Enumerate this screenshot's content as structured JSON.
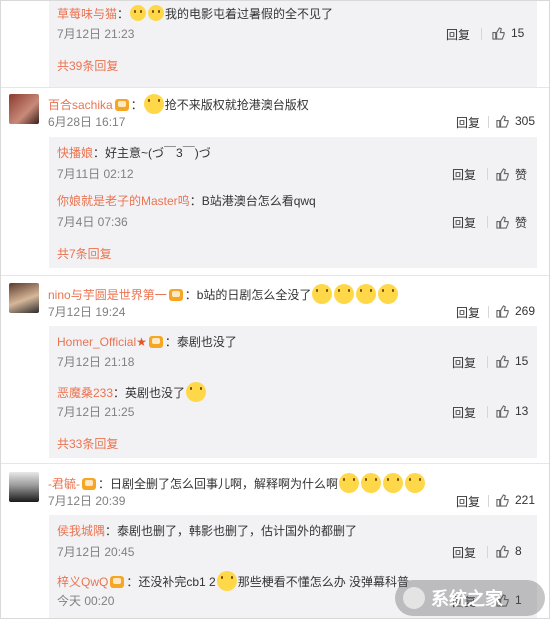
{
  "comments": [
    {
      "user": "草莓味与猫",
      "text": "我的电影屯着过暑假的全不见了",
      "date": "7月12日 21:23",
      "reply_label": "回复",
      "likes": "15"
    },
    {
      "more_label": "共39条回复"
    },
    {
      "user": "百合sachika",
      "text": "抢不来版权就抢港澳台版权",
      "date": "6月28日 16:17",
      "reply_label": "回复",
      "likes": "305",
      "replies": [
        {
          "user": "快播娘",
          "text": "：好主意~(づ￣3￣)づ",
          "date": "7月11日 02:12",
          "reply_label": "回复",
          "likes": "赞"
        },
        {
          "user": "你娘就是老子的Master呜",
          "text": "：B站港澳台怎么看qwq",
          "date": "7月4日 07:36",
          "reply_label": "回复",
          "likes": "赞"
        }
      ],
      "more_label": "共7条回复"
    },
    {
      "user": "nino与芋圆是世界第一",
      "text": "：b站的日剧怎么全没了",
      "date": "7月12日 19:24",
      "reply_label": "回复",
      "likes": "269",
      "replies": [
        {
          "user": "Homer_Official",
          "text": "：泰剧也没了",
          "date": "7月12日 21:18",
          "reply_label": "回复",
          "likes": "15"
        },
        {
          "user": "恶魔桑233",
          "text": "：英剧也没了",
          "date": "7月12日 21:25",
          "reply_label": "回复",
          "likes": "13"
        }
      ],
      "more_label": "共33条回复"
    },
    {
      "user": "-君毓-",
      "text": "：日剧全删了怎么回事儿啊，解释啊为什么啊",
      "date": "7月12日 20:39",
      "reply_label": "回复",
      "likes": "221",
      "replies": [
        {
          "user": "侯我城隅",
          "text": "：泰剧也删了，韩影也删了，估计国外的都删了",
          "date": "7月12日 20:45",
          "reply_label": "回复",
          "likes": "8"
        },
        {
          "user": "梓义QwQ",
          "text": "：还没补完cb1 2",
          "text2": "那些梗看不懂怎么办 没弹幕科普",
          "date": "今天 00:20",
          "reply_label": "回复",
          "likes": "1"
        }
      ]
    }
  ],
  "watermark": {
    "text": "系统之家"
  },
  "colors": {
    "username": "#eb7350",
    "reply_bg": "#f2f2f5",
    "divider": "#e6e6e6"
  }
}
